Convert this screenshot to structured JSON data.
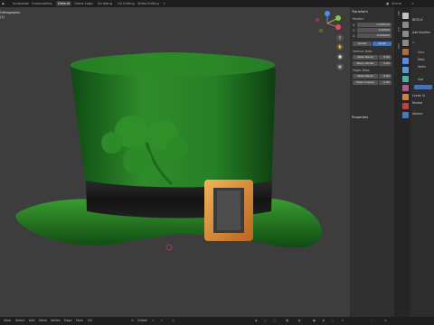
{
  "topbar": {
    "tabs": [
      "Animation",
      "Compositing",
      "Default",
      "Game Logic",
      "Scripting",
      "UV Editing",
      "Video Editing",
      "+"
    ],
    "active_tab": "Default",
    "scene_label": "Scene"
  },
  "viewport": {
    "overlay_title": "Orthographic",
    "overlay_sub": "(1)",
    "hat_colors": {
      "hat_green": "#2f8c2a",
      "hat_dark": "#0f4a13",
      "band": "#1b1b1b",
      "buckle": "#d88a3a",
      "buckle_inner": "#3a3a3a"
    },
    "header_menus": [
      "View",
      "Select",
      "Add",
      "Mesh",
      "Vertex",
      "Edge",
      "Face",
      "UV"
    ],
    "bottom_toolbar": {
      "mode_label": "Global"
    }
  },
  "n_panel": {
    "section_transform": "Transform",
    "median_label": "Median:",
    "x_label": "X:",
    "y_label": "Y:",
    "z_label": "Z:",
    "x_value": "0.000210",
    "y_value": "0.00000",
    "z_value": "0.000000",
    "global_btn": "Global",
    "local_btn": "Local",
    "vertices_data_label": "Vertices Data:",
    "mean_bevel_label": "Mean Bevel",
    "mean_bevel_value": "0.00",
    "mean_vertex_label": "Mean Vertex",
    "mean_vertex_value": "0.00",
    "edges_data_label": "Edges Data:",
    "mean_bevel2_label": "Mean Bevel",
    "mean_bevel2_value": "0.00",
    "mean_crease_label": "Mean Crease",
    "mean_crease_value": "0.00",
    "section_properties": "Properties",
    "tabs": [
      "Item",
      "Tool",
      "View"
    ]
  },
  "properties": {
    "object_name": "BEZIUS",
    "add_modifier_label": "Add Modifier",
    "lines": [
      "Curv",
      "Defo",
      "Vertic",
      "Sub",
      "Levels Vi",
      "Render",
      "Advanc"
    ]
  },
  "statusbar": {
    "left_items": [
      "View",
      "Select",
      "Add",
      "Mesh",
      "Vertex",
      "Edge",
      "Face",
      "UV"
    ]
  },
  "gizmo": {
    "x_color": "#e04f5f",
    "y_color": "#8cc83f",
    "z_color": "#4f8fe6"
  }
}
